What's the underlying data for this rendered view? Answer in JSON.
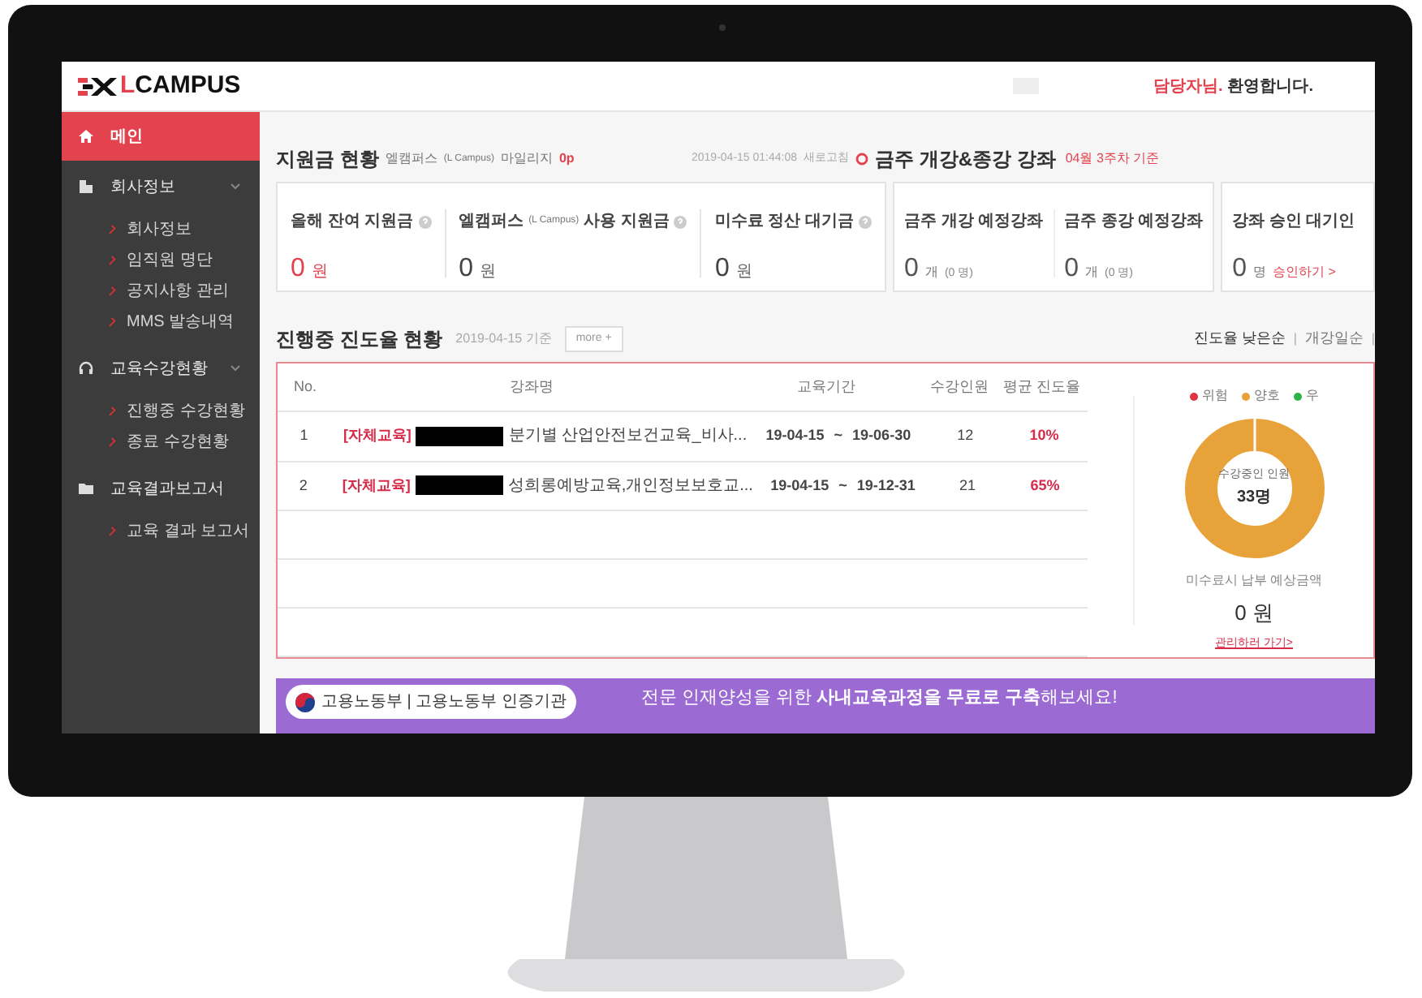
{
  "header": {
    "logo": {
      "accent": "L",
      "text": "CAMPUS"
    },
    "greeting": {
      "name": "담당자님.",
      "message": "환영합니다."
    }
  },
  "sidebar": {
    "items": [
      {
        "kind": "home",
        "label": "메인",
        "selected": true,
        "collapsible": false
      },
      {
        "kind": "building",
        "label": "회사정보",
        "selected": false,
        "collapsible": true,
        "children": [
          "회사정보",
          "임직원 명단",
          "공지사항 관리",
          "MMS 발송내역"
        ]
      },
      {
        "kind": "headset",
        "label": "교육수강현황",
        "selected": false,
        "collapsible": true,
        "children": [
          "진행중 수강현황",
          "종료 수강현황"
        ]
      },
      {
        "kind": "folder",
        "label": "교육결과보고서",
        "selected": false,
        "collapsible": false,
        "children": [
          "교육 결과 보고서"
        ]
      }
    ]
  },
  "subsidy": {
    "title": "지원금 현황",
    "mileage": {
      "label": "엘캠퍼스",
      "note": "(L Campus)",
      "suffix": "마일리지",
      "value": "0p"
    },
    "timestamp": "2019-04-15 01:44:08",
    "refresh": "새로고침",
    "cards": [
      {
        "label": "올해 잔여 지원금",
        "value": "0",
        "unit": "원",
        "highlight": true
      },
      {
        "label": "엘캠퍼스",
        "note": "(L Campus)",
        "label_after": "사용 지원금",
        "value": "0",
        "unit": "원",
        "highlight": false
      },
      {
        "label": "미수료 정산 대기금",
        "value": "0",
        "unit": "원",
        "highlight": false
      }
    ]
  },
  "weekly": {
    "title": "금주 개강&종강 강좌",
    "basis": "04월 3주차 기준",
    "cards": [
      {
        "label": "금주 개강 예정강좌",
        "value": "0",
        "unit": "개",
        "detail": "(0 명)"
      },
      {
        "label": "금주 종강 예정강좌",
        "value": "0",
        "unit": "개",
        "detail": "(0 명)"
      }
    ]
  },
  "approval": {
    "label": "강좌 승인 대기인",
    "value": "0",
    "unit": "명",
    "link": "승인하기 >"
  },
  "progress": {
    "title": "진행중 진도율 현황",
    "basis": "2019-04-15 기준",
    "more": "more +",
    "sorts": [
      "진도율 낮은순",
      "개강일순"
    ],
    "separator": "|",
    "table": {
      "columns": [
        "No.",
        "강좌명",
        "교육기간",
        "수강인원",
        "평균 진도율"
      ],
      "rows": [
        {
          "no": "1",
          "tag": "[자체교육]",
          "name": "분기별 산업안전보건교육_비사...",
          "start": "19-04-15",
          "sep": "~",
          "end": "19-06-30",
          "count": "12",
          "avg": "10%"
        },
        {
          "no": "2",
          "tag": "[자체교육]",
          "name": "성희롱예방교육,개인정보보호교...",
          "start": "19-04-15",
          "sep": "~",
          "end": "19-12-31",
          "count": "21",
          "avg": "65%"
        }
      ]
    },
    "summary": {
      "legend": [
        {
          "label": "위험",
          "color": "#e0343f"
        },
        {
          "label": "양호",
          "color": "#e8a23a"
        },
        {
          "label": "우",
          "color": "#2db34a"
        }
      ],
      "donut_label": "수강중인 인원",
      "donut_value": "33명",
      "fee_label": "미수료시 납부 예상금액",
      "fee_value": "0 원",
      "link": "관리하러 가기>"
    }
  },
  "banner": {
    "badge": "고용노동부 | 고용노동부 인증기관",
    "text": "전문 인재양성을 위한 **사내교육과정을 무료로 구축**해보세요!"
  }
}
